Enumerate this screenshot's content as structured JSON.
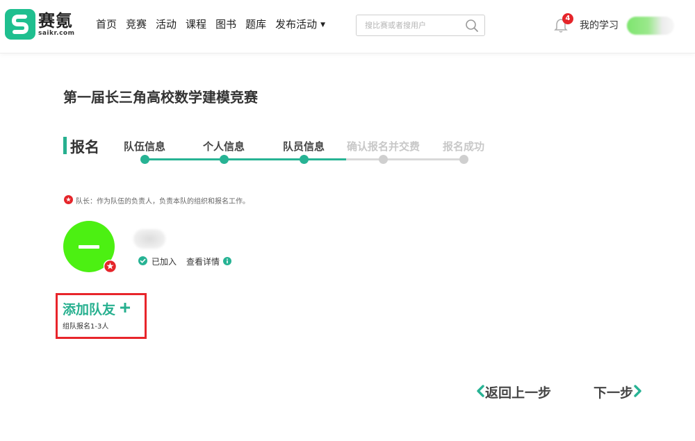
{
  "header": {
    "logo": {
      "title": "赛氪",
      "subtitle": "saikr.com",
      "brand_color": "#1fbf8f"
    },
    "nav": [
      {
        "label": "首页"
      },
      {
        "label": "竞赛"
      },
      {
        "label": "活动"
      },
      {
        "label": "课程"
      },
      {
        "label": "图书"
      },
      {
        "label": "题库"
      },
      {
        "label": "发布活动",
        "has_dropdown": true
      }
    ],
    "search": {
      "placeholder": "搜比赛或者搜用户",
      "icon": "search-icon"
    },
    "notifications": {
      "count": "4",
      "icon": "bell-icon",
      "badge_color": "#e5252a"
    },
    "my_study_label": "我的学习"
  },
  "main": {
    "title": "第一届长三角高校数学建模竞赛",
    "section_title": "报名",
    "accent_color": "#27b08f",
    "steps": [
      {
        "label": "队伍信息",
        "done": true
      },
      {
        "label": "个人信息",
        "done": true
      },
      {
        "label": "队员信息",
        "done": true
      },
      {
        "label": "确认报名并交费",
        "done": false
      },
      {
        "label": "报名成功",
        "done": false
      }
    ],
    "leader_note": "队长：作为队伍的负责人，负责本队的组织和报名工作。",
    "member": {
      "avatar_color": "#4cf012",
      "status": "已加入",
      "detail_link": "查看详情"
    },
    "add_teammate": {
      "label": "添加队友",
      "hint": "组队报名1-3人",
      "highlight_color": "#e8252b"
    },
    "buttons": {
      "back": "返回上一步",
      "next": "下一步"
    }
  }
}
